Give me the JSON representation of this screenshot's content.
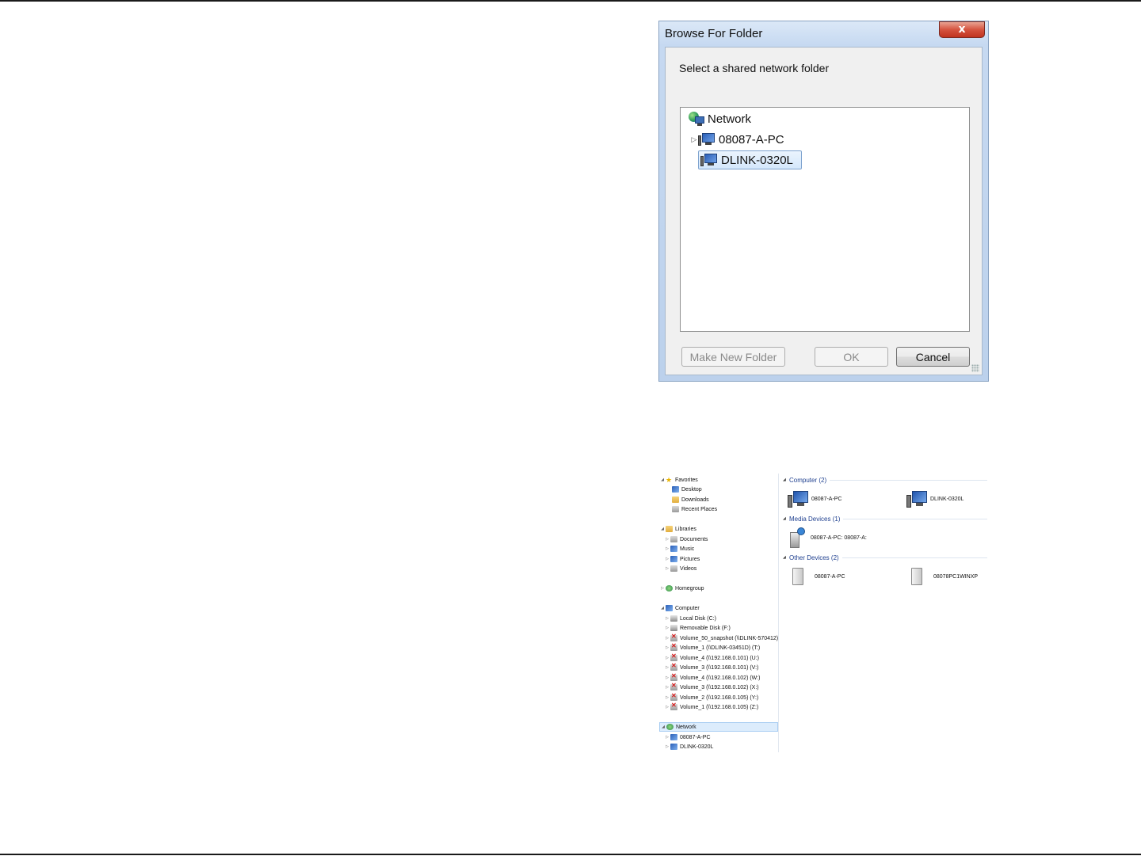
{
  "dialog": {
    "title": "Browse For Folder",
    "close_label": "x",
    "prompt": "Select a shared network folder",
    "tree": {
      "root": "Network",
      "items": [
        "08087-A-PC",
        "DLINK-0320L"
      ],
      "selected": "DLINK-0320L"
    },
    "buttons": {
      "make_new_folder": "Make New Folder",
      "ok": "OK",
      "cancel": "Cancel"
    }
  },
  "explorer": {
    "nav": {
      "favorites": "Favorites",
      "desktop": "Desktop",
      "downloads": "Downloads",
      "recent_places": "Recent Places",
      "libraries": "Libraries",
      "documents": "Documents",
      "music": "Music",
      "pictures": "Pictures",
      "videos": "Videos",
      "homegroup": "Homegroup",
      "computer": "Computer",
      "local_disk": "Local Disk (C:)",
      "removable_disk": "Removable Disk (F:)",
      "volumes": [
        "Volume_50_snapshot (\\\\DLINK-570412)",
        "Volume_1 (\\\\DLINK-03451D) (T:)",
        "Volume_4 (\\\\192.168.0.101) (U:)",
        "Volume_3 (\\\\192.168.0.101) (V:)",
        "Volume_4 (\\\\192.168.0.102) (W:)",
        "Volume_3 (\\\\192.168.0.102) (X:)",
        "Volume_2 (\\\\192.168.0.105) (Y:)",
        "Volume_1 (\\\\192.168.0.105) (Z:)"
      ],
      "network": "Network",
      "network_items": [
        "08087-A-PC",
        "DLINK-0320L"
      ]
    },
    "groups": {
      "computer": "Computer (2)",
      "media": "Media Devices (1)",
      "other": "Other Devices (2)"
    },
    "computers": [
      "08087-A-PC",
      "DLINK-0320L"
    ],
    "media_devices": [
      "08087-A-PC: 08087-A:"
    ],
    "other_devices": [
      "08087-A-PC",
      "08078PC1WINXP"
    ]
  }
}
